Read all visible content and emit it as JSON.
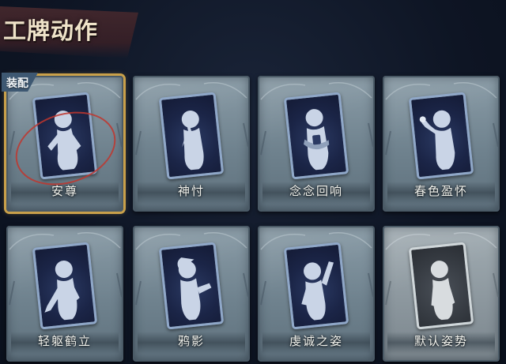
{
  "header": {
    "title": "工牌动作"
  },
  "equipped_badge": "装配",
  "colors": {
    "background": "#10182a",
    "card_frame": "#7d8f9a",
    "card_inner": "#1b2547",
    "equipped_border": "#c9a04a",
    "badge": "#3e5872",
    "highlight_ring": "#c0362e"
  },
  "cards": [
    {
      "label": "安尊",
      "equipped": true,
      "pose_icon": "pose-hand-on-hip-icon"
    },
    {
      "label": "神忖",
      "equipped": false,
      "pose_icon": "pose-thinking-icon"
    },
    {
      "label": "念念回响",
      "equipped": false,
      "pose_icon": "pose-hug-icon"
    },
    {
      "label": "春色盈怀",
      "equipped": false,
      "pose_icon": "pose-flower-icon"
    },
    {
      "label": "轻躯鹤立",
      "equipped": false,
      "pose_icon": "pose-crane-stand-icon"
    },
    {
      "label": "鸦影",
      "equipped": false,
      "pose_icon": "pose-crow-shadow-icon"
    },
    {
      "label": "虔诚之姿",
      "equipped": false,
      "pose_icon": "pose-devout-icon"
    },
    {
      "label": "默认姿势",
      "equipped": false,
      "pose_icon": "pose-default-icon"
    }
  ]
}
